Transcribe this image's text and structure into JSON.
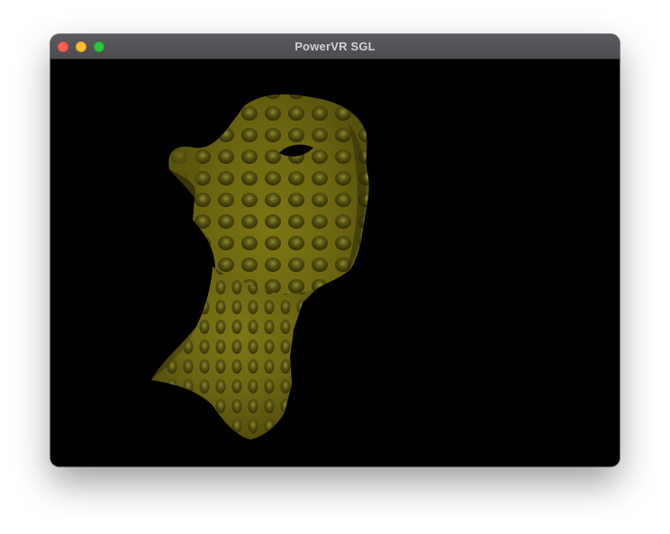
{
  "window": {
    "title": "PowerVR SGL",
    "controls": {
      "close_color": "#fe5f57",
      "minimize_color": "#febc2e",
      "zoom_color": "#28c840"
    }
  },
  "viewport": {
    "background_color": "#000000",
    "scene": "textured-3d-head-model",
    "texture_color": "#6b6410"
  }
}
